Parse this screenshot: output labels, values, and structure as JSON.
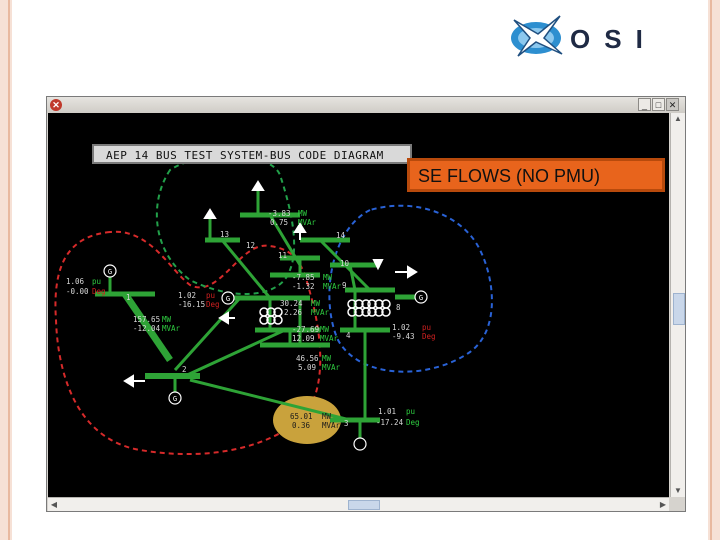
{
  "logo": {
    "text": "OSI",
    "icon": "osi-star-logo-icon"
  },
  "window": {
    "system_icon": "app-close-icon",
    "buttons": [
      "minimize",
      "maximize",
      "close"
    ]
  },
  "diagram": {
    "title": "AEP 14 BUS TEST SYSTEM-BUS CODE DIAGRAM",
    "callout": "SE FLOWS (NO PMU)",
    "labels": [
      {
        "id": "b2-v",
        "text": "1.06"
      },
      {
        "id": "b2-a",
        "text": "-0.00"
      },
      {
        "id": "b2-u1",
        "text": "pu"
      },
      {
        "id": "b2-u2",
        "text": "Deg"
      },
      {
        "id": "b1-num",
        "text": "1"
      },
      {
        "id": "b5-v",
        "text": "1.02"
      },
      {
        "id": "b5-a",
        "text": "-16.15"
      },
      {
        "id": "b5-u1",
        "text": "pu"
      },
      {
        "id": "b5-u2",
        "text": "Deg"
      },
      {
        "id": "f1-mw",
        "text": "157.65"
      },
      {
        "id": "f1-mvar",
        "text": "-12.04"
      },
      {
        "id": "f1-u1",
        "text": "MW"
      },
      {
        "id": "f1-u2",
        "text": "MVAr"
      },
      {
        "id": "f2-mw",
        "text": "-3.83"
      },
      {
        "id": "f2-mvar",
        "text": "0.75"
      },
      {
        "id": "f2-u1",
        "text": "MW"
      },
      {
        "id": "f2-u2",
        "text": "MVAr"
      },
      {
        "id": "b13-num",
        "text": "13"
      },
      {
        "id": "b14-num",
        "text": "14"
      },
      {
        "id": "b12-num",
        "text": "12"
      },
      {
        "id": "b11-num",
        "text": "11"
      },
      {
        "id": "b10-num",
        "text": "10"
      },
      {
        "id": "f3-mw",
        "text": "-7.85"
      },
      {
        "id": "f3-mvar",
        "text": "-1.32"
      },
      {
        "id": "f3-u1",
        "text": "MW"
      },
      {
        "id": "f3-u2",
        "text": "MVAr"
      },
      {
        "id": "f4-mw",
        "text": "30.24"
      },
      {
        "id": "f4-mvar",
        "text": "2.26"
      },
      {
        "id": "f4-u1",
        "text": "MW"
      },
      {
        "id": "f4-u2",
        "text": "MVAr"
      },
      {
        "id": "b9-num",
        "text": "9"
      },
      {
        "id": "b8-num",
        "text": "8"
      },
      {
        "id": "b9-v",
        "text": "1.02"
      },
      {
        "id": "b9-a",
        "text": "-9.43"
      },
      {
        "id": "b9-u1",
        "text": "pu"
      },
      {
        "id": "b9-u2",
        "text": "Deg"
      },
      {
        "id": "f5-mw",
        "text": "-27.69"
      },
      {
        "id": "f5-mvar",
        "text": "12.09"
      },
      {
        "id": "f5-u1",
        "text": "MW"
      },
      {
        "id": "f5-u2",
        "text": "MVAr"
      },
      {
        "id": "f6-mw",
        "text": "46.56"
      },
      {
        "id": "f6-mvar",
        "text": "5.09"
      },
      {
        "id": "f6-u1",
        "text": "MW"
      },
      {
        "id": "f6-u2",
        "text": "MVAr"
      },
      {
        "id": "b4-num",
        "text": "4"
      },
      {
        "id": "b2b-num",
        "text": "2"
      },
      {
        "id": "f7-mw",
        "text": "65.01"
      },
      {
        "id": "f7-mvar",
        "text": "0.36"
      },
      {
        "id": "f7-u1",
        "text": "MW"
      },
      {
        "id": "f7-u2",
        "text": "MVAr"
      },
      {
        "id": "b3-v",
        "text": "1.01"
      },
      {
        "id": "b3-a",
        "text": "-17.24"
      },
      {
        "id": "b3-u1",
        "text": "pu"
      },
      {
        "id": "b3-u2",
        "text": "Deg"
      },
      {
        "id": "b3-num",
        "text": "3"
      },
      {
        "id": "g1",
        "text": "G"
      },
      {
        "id": "g2",
        "text": "G"
      },
      {
        "id": "g3",
        "text": "G"
      },
      {
        "id": "g4",
        "text": "G"
      },
      {
        "id": "g5",
        "text": "G"
      }
    ]
  },
  "colors": {
    "bus": "#2ea336",
    "text": "#d8d8d8",
    "unit_mw": "#2ecc40",
    "unit_deg": "#d02020",
    "zone_red": "#d62a2a",
    "zone_green": "#22a04a",
    "zone_blue": "#2962d6",
    "highlight": "#c9a23c",
    "callout": "#e8641c"
  }
}
